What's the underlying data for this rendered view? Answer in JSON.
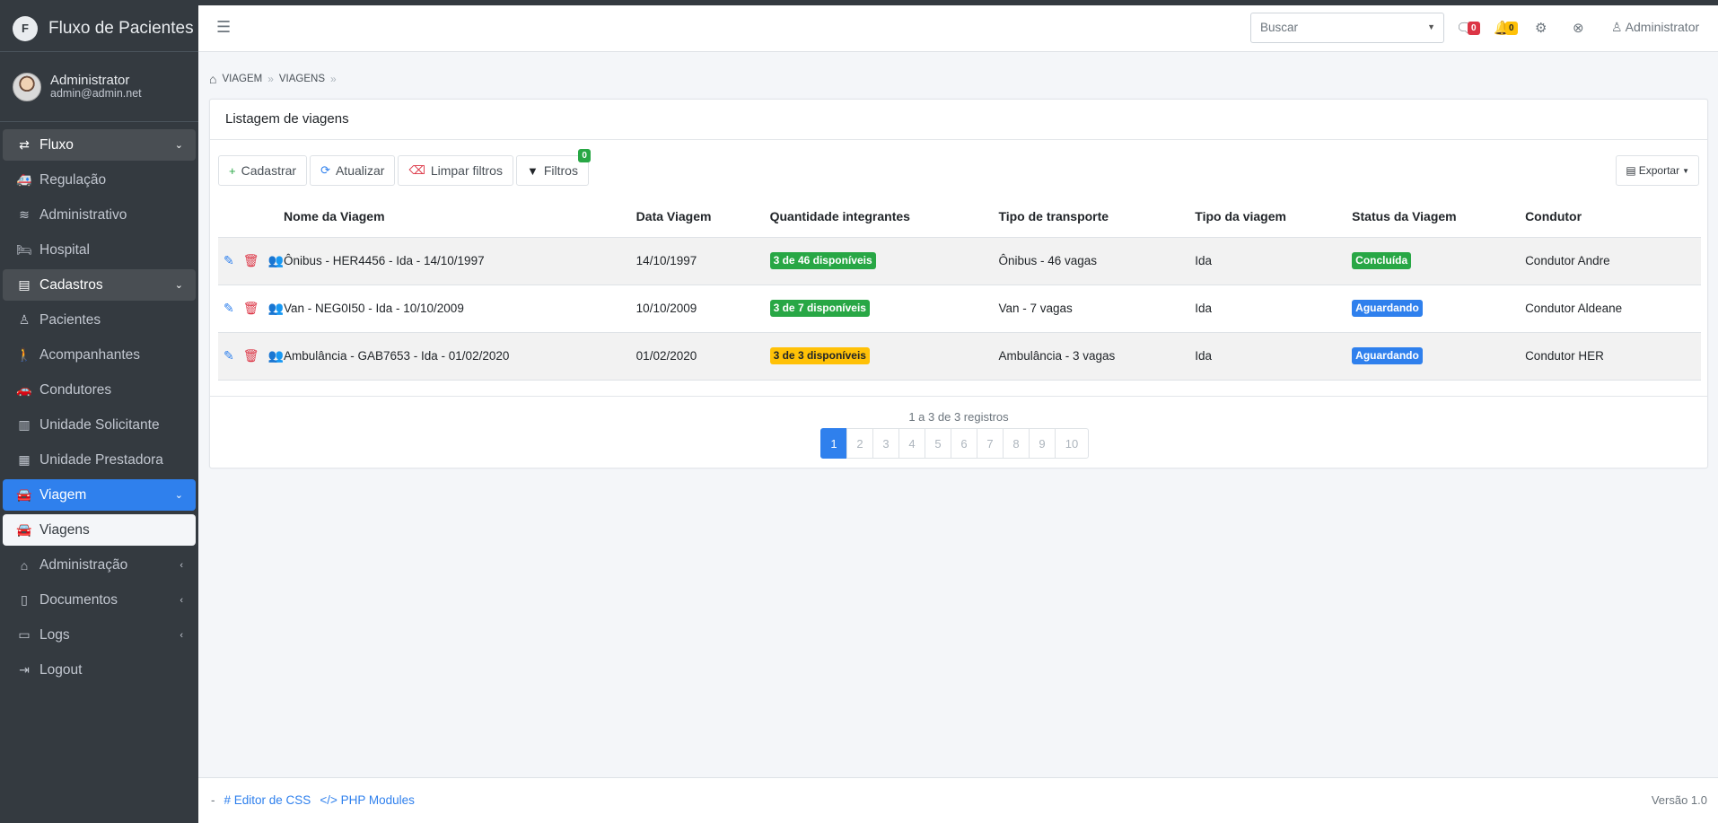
{
  "brand": {
    "logo_letter": "F",
    "title": "Fluxo de Pacientes"
  },
  "user": {
    "name": "Administrator",
    "email": "admin@admin.net"
  },
  "sidebar": {
    "items": [
      {
        "label": "Fluxo",
        "icon": "exchange-icon",
        "glyph": "⇄",
        "state": "open",
        "chevron": "⌄"
      },
      {
        "label": "Regulação",
        "icon": "ambulance-icon",
        "glyph": "🚑",
        "state": ""
      },
      {
        "label": "Administrativo",
        "icon": "layers-icon",
        "glyph": "≋",
        "state": ""
      },
      {
        "label": "Hospital",
        "icon": "hospital-bed-icon",
        "glyph": "🛏",
        "state": ""
      },
      {
        "label": "Cadastros",
        "icon": "id-card-icon",
        "glyph": "▤",
        "state": "open",
        "chevron": "⌄"
      },
      {
        "label": "Pacientes",
        "icon": "user-icon",
        "glyph": "♙",
        "state": ""
      },
      {
        "label": "Acompanhantes",
        "icon": "person-icon",
        "glyph": "🚶",
        "state": ""
      },
      {
        "label": "Condutores",
        "icon": "car-side-icon",
        "glyph": "🚗",
        "state": ""
      },
      {
        "label": "Unidade Solicitante",
        "icon": "building-icon",
        "glyph": "▥",
        "state": ""
      },
      {
        "label": "Unidade Prestadora",
        "icon": "hospital-icon",
        "glyph": "▦",
        "state": ""
      },
      {
        "label": "Viagem",
        "icon": "car-icon",
        "glyph": "🚘",
        "state": "active",
        "chevron": "⌄"
      },
      {
        "label": "Viagens",
        "icon": "car-icon",
        "glyph": "🚘",
        "state": "sub-active"
      },
      {
        "label": "Administração",
        "icon": "home-icon",
        "glyph": "⌂",
        "state": "",
        "chevron": "‹"
      },
      {
        "label": "Documentos",
        "icon": "file-icon",
        "glyph": "▯",
        "state": "",
        "chevron": "‹"
      },
      {
        "label": "Logs",
        "icon": "monitor-icon",
        "glyph": "▭",
        "state": "",
        "chevron": "‹"
      },
      {
        "label": "Logout",
        "icon": "sign-out-icon",
        "glyph": "⇥",
        "state": ""
      }
    ]
  },
  "header": {
    "search_placeholder": "Buscar",
    "messages_count": "0",
    "notifications_count": "0",
    "user_label": "Administrator"
  },
  "breadcrumb": {
    "items": [
      "VIAGEM",
      "VIAGENS"
    ]
  },
  "card": {
    "title": "Listagem de viagens",
    "buttons": {
      "cadastrar": "Cadastrar",
      "atualizar": "Atualizar",
      "limpar": "Limpar filtros",
      "filtros": "Filtros",
      "filtros_count": "0",
      "exportar": "Exportar"
    }
  },
  "table": {
    "columns": [
      "Nome da Viagem",
      "Data Viagem",
      "Quantidade integrantes",
      "Tipo de transporte",
      "Tipo da viagem",
      "Status da Viagem",
      "Condutor"
    ],
    "rows": [
      {
        "nome": "Ônibus - HER4456 - Ida - 14/10/1997",
        "data": "14/10/1997",
        "qtd": "3 de 46 disponíveis",
        "qtd_color": "green",
        "transporte": "Ônibus - 46 vagas",
        "tipo": "Ida",
        "status": "Concluída",
        "status_color": "green",
        "condutor": "Condutor Andre"
      },
      {
        "nome": "Van - NEG0I50 - Ida - 10/10/2009",
        "data": "10/10/2009",
        "qtd": "3 de 7 disponíveis",
        "qtd_color": "green",
        "transporte": "Van - 7 vagas",
        "tipo": "Ida",
        "status": "Aguardando",
        "status_color": "blue",
        "condutor": "Condutor Aldeane"
      },
      {
        "nome": "Ambulância - GAB7653 - Ida - 01/02/2020",
        "data": "01/02/2020",
        "qtd": "3 de 3 disponíveis",
        "qtd_color": "yellow",
        "transporte": "Ambulância - 3 vagas",
        "tipo": "Ida",
        "status": "Aguardando",
        "status_color": "blue",
        "condutor": "Condutor HER"
      }
    ]
  },
  "pagination": {
    "info": "1 a 3 de 3 registros",
    "pages": [
      "1",
      "2",
      "3",
      "4",
      "5",
      "6",
      "7",
      "8",
      "9",
      "10"
    ],
    "current": "1"
  },
  "footer": {
    "dash": "-",
    "css_editor": "Editor de CSS",
    "php_modules": "PHP Modules",
    "version": "Versão 1.0"
  }
}
